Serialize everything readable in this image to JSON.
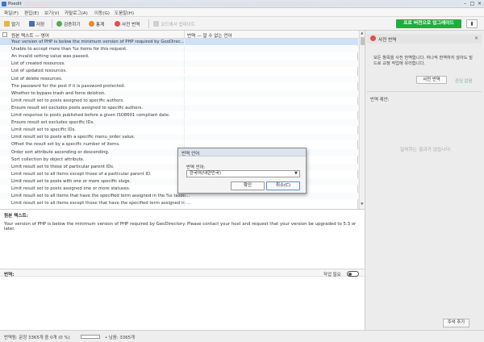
{
  "window": {
    "title": "Poedit"
  },
  "menu": [
    "파일(F)",
    "편집(E)",
    "보기(V)",
    "카탈로그(A)",
    "이동(G)",
    "도움말(H)"
  ],
  "toolbar": {
    "open": "열기",
    "save": "저장",
    "validate": "검증하기",
    "stats": "통계",
    "pretranslate": "사전 번역",
    "update_from_code": "코드에서 업데이트",
    "upgrade": "프로 버전으로 업그레이드"
  },
  "list": {
    "col_source": "원본 텍스트 — 영어",
    "col_translation": "번역 — 알 수 없는 언어",
    "rows": [
      "Your version of PHP is below the minimum version of PHP required by GeoDirec...",
      "Unable to accept more than %s items for this request.",
      "An invalid setting value was passed.",
      "List of created resources.",
      "List of updated resources.",
      "List of delete resources.",
      "The password for the post if it is password protected.",
      "Whether to bypass trash and force deletion.",
      "Limit result set to posts assigned to specific authors.",
      "Ensure result set excludes posts assigned to specific authors.",
      "Limit response to posts published before a given ISO8601 compliant date.",
      "Ensure result set excludes specific IDs.",
      "Limit result set to specific IDs.",
      "Limit result set to posts with a specific menu_order value.",
      "Offset the result set by a specific number of items.",
      "Order sort attribute ascending or descending.",
      "Sort collection by object attribute.",
      "Limit result set to those of particular parent IDs.",
      "Limit result set to all items except those of a particular parent ID.",
      "Limit result set to posts with one or more specific slugs.",
      "Limit result set to posts assigned one or more statuses.",
      "Limit result set to all items that have the specified term assigned in the %s taxon...",
      "Limit result set to all items except those that have the specified term assigned in ..."
    ]
  },
  "source": {
    "label": "원본 텍스트:",
    "text": "Your version of PHP is below the minimum version of PHP required by GeoDirectory. Please contact your host and request that your version be upgraded to 5.3 or later."
  },
  "translation": {
    "label": "번역:",
    "needs_work": "작업 필요"
  },
  "sidebar": {
    "title": "사전 번역",
    "message": "모든 항목을 사전 번역합니다. 하나씩 번역하지 않아도 빌드로 교정 작업에 유리합니다.",
    "pretranslate_button": "사전 번역",
    "not_interested": "관심 없음",
    "suggestions_label": "번역 제안:",
    "no_match": "일치하는 결과가 없습니다",
    "add_comment": "주석 추가"
  },
  "status": {
    "text": "번역됨: 문장 3365개 중 0개 (0 %)",
    "progress_fraction": 0.0,
    "remaining": "• 남음: 3365개"
  },
  "dialog": {
    "title": "번역 언어",
    "label": "번역 언어:",
    "selected": "한국어(대한민국)",
    "ok": "확인",
    "cancel": "취소(C)"
  },
  "colors": {
    "accent_green": "#1fae3c",
    "selection": "#cfe1f7"
  }
}
